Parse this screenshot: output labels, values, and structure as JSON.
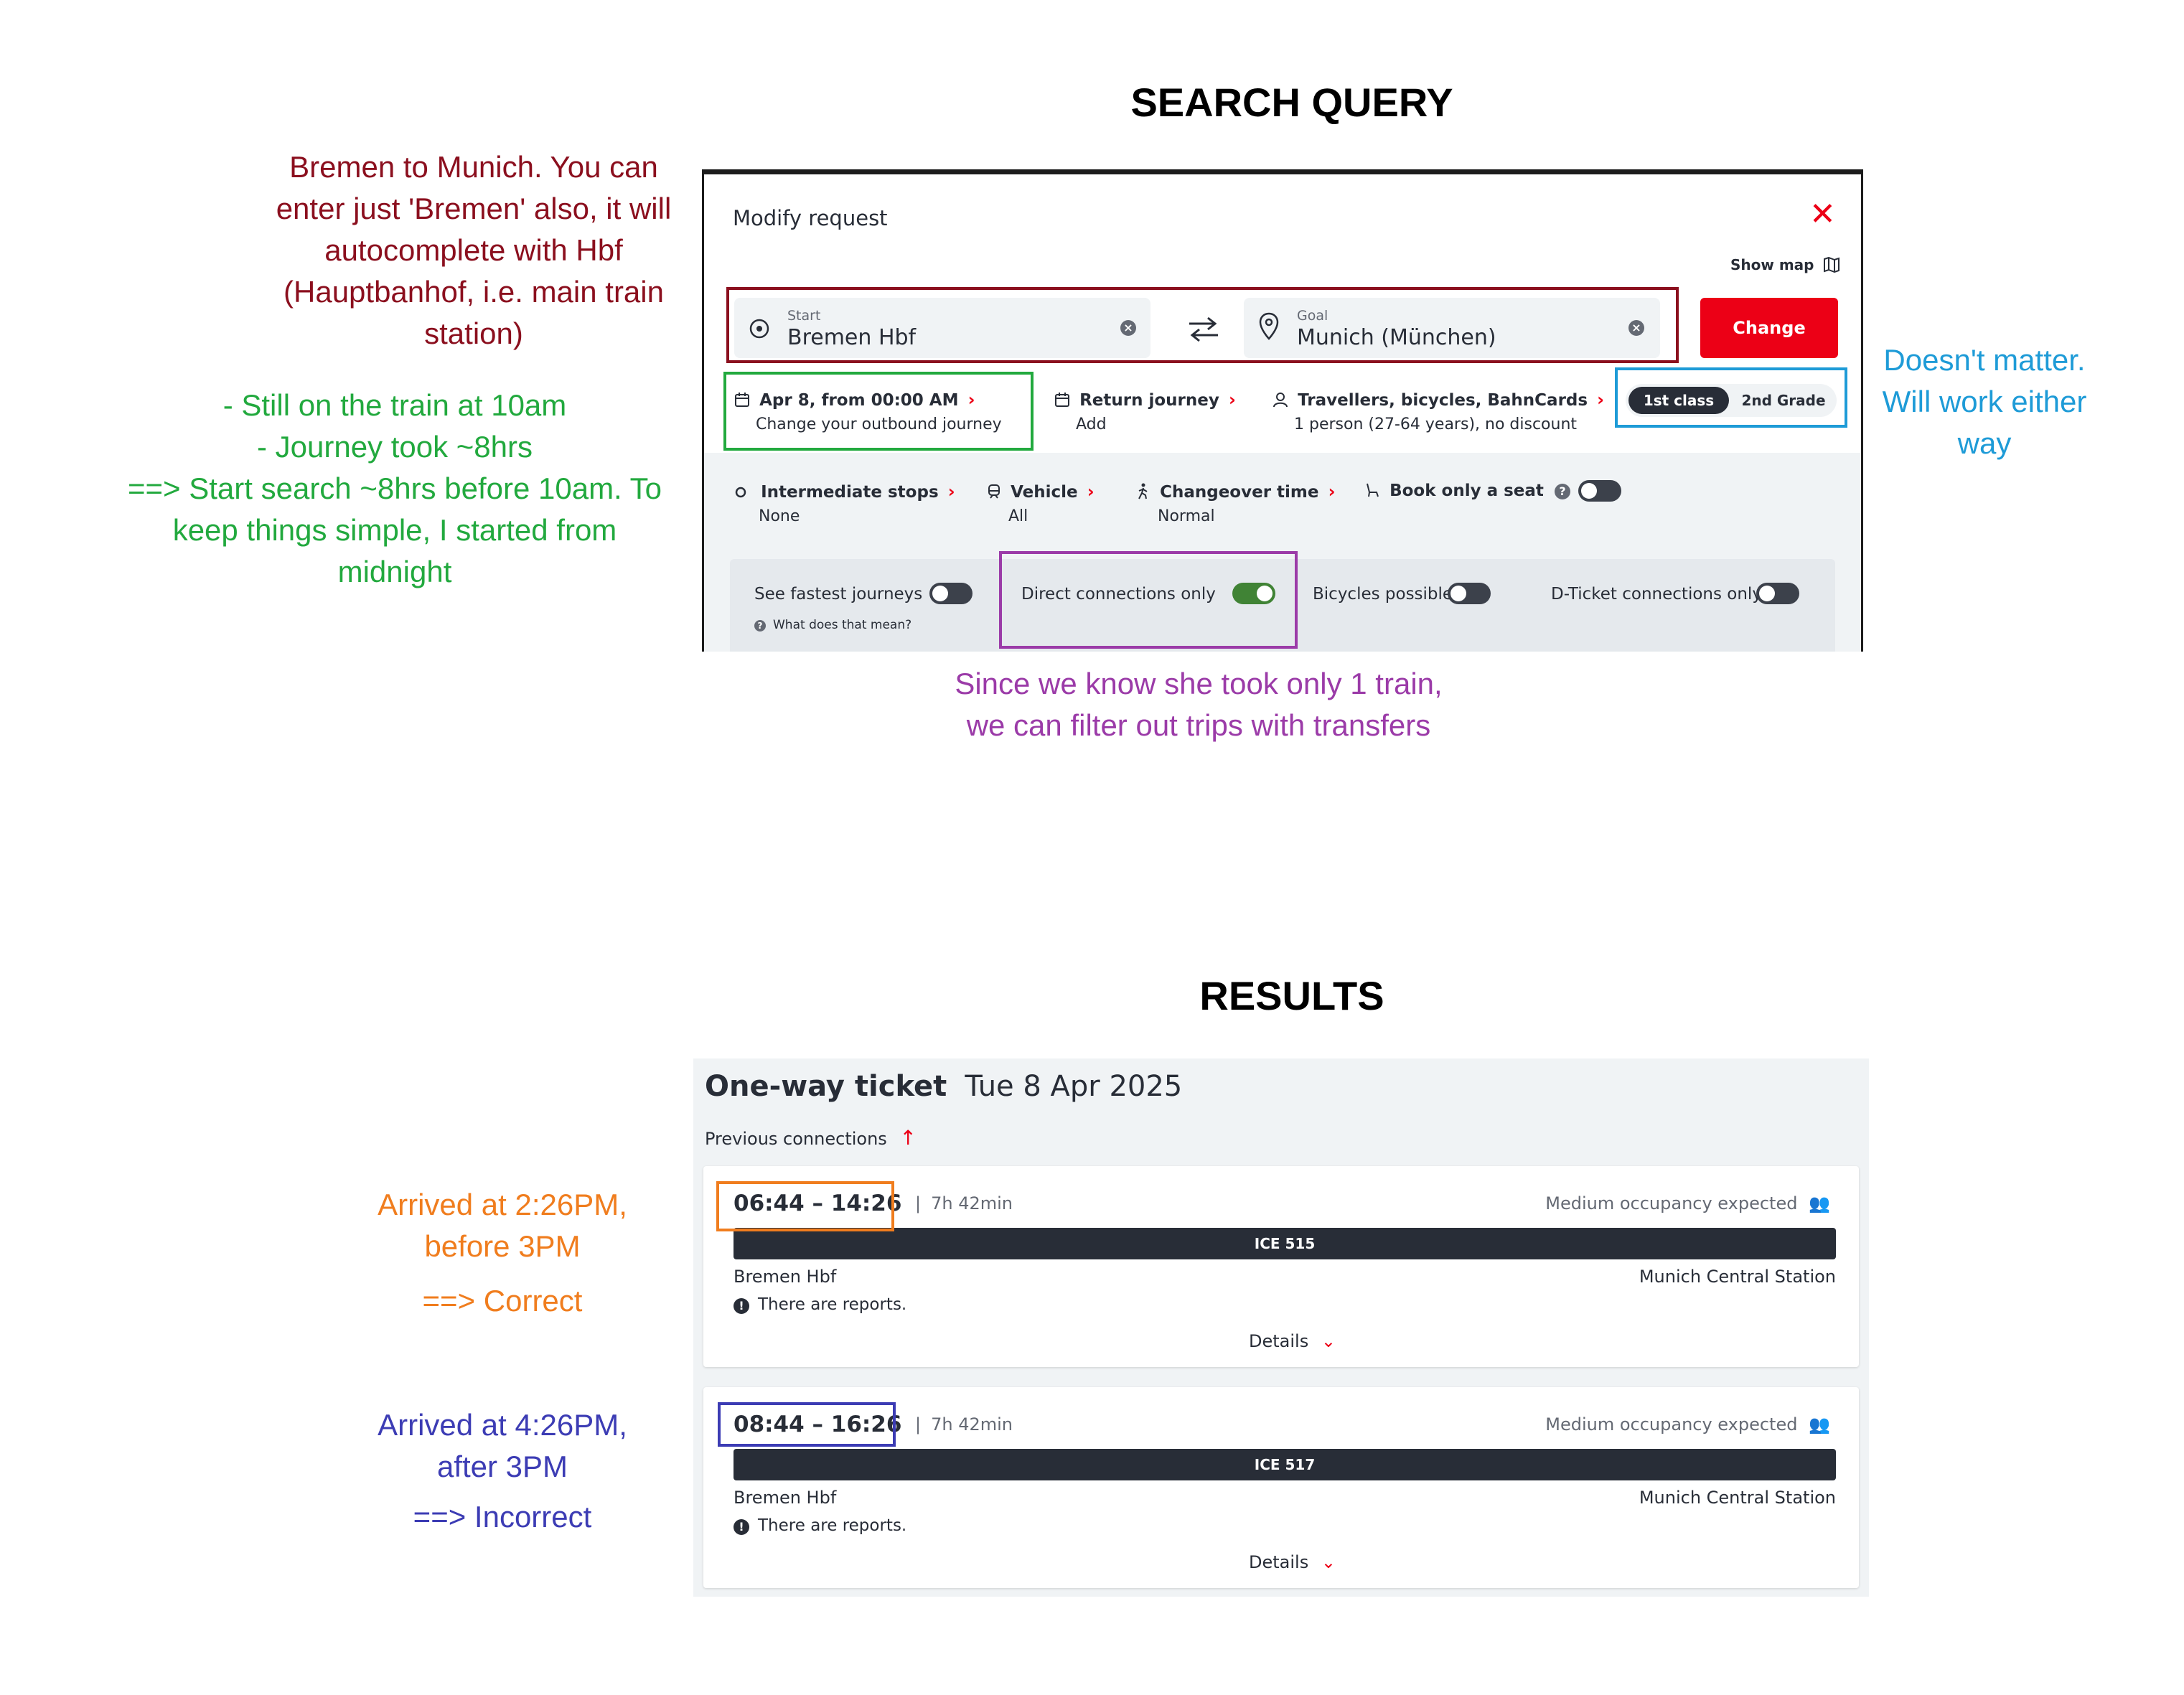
{
  "headings": {
    "search": "SEARCH QUERY",
    "results": "RESULTS"
  },
  "annotations": {
    "route": [
      "Bremen to Munich. You can",
      "enter just 'Bremen' also, it will",
      "autocomplete with Hbf",
      "(Hauptbanhof, i.e. main train",
      "station)"
    ],
    "time": [
      "- Still on the train at 10am",
      "- Journey took ~8hrs",
      "==> Start search ~8hrs before 10am. To",
      "keep things simple, I started from",
      "midnight"
    ],
    "class": [
      "Doesn't matter.",
      "Will work either",
      "way"
    ],
    "direct": [
      "Since we know she took only 1 train,",
      "we can filter out trips with transfers"
    ],
    "result1": [
      "Arrived at 2:26PM,",
      "before 3PM",
      "==> Correct"
    ],
    "result2": [
      "Arrived at 4:26PM,",
      "after 3PM",
      "==> Incorrect"
    ]
  },
  "colors": {
    "route": "#8b0f1e",
    "time": "#22a93e",
    "class": "#1e9bd7",
    "direct": "#9b3ba8",
    "result1": "#f07d1e",
    "result2": "#3c3cb4",
    "brand_red": "#ec0016",
    "toggle_on": "#408335"
  },
  "search": {
    "title": "Modify request",
    "close_icon": "close-icon",
    "show_map": "Show map",
    "start": {
      "label": "Start",
      "value": "Bremen Hbf"
    },
    "goal": {
      "label": "Goal",
      "value": "Munich (München)"
    },
    "change_button": "Change",
    "outbound": {
      "title": "Apr 8, from 00:00 AM",
      "sub": "Change your outbound journey"
    },
    "return": {
      "title": "Return journey",
      "sub": "Add"
    },
    "travellers": {
      "title": "Travellers, bicycles, BahnCards",
      "sub": "1 person (27-64 years), no discount"
    },
    "class_options": [
      "1st class",
      "2nd Grade"
    ],
    "class_selected": 0,
    "stops": {
      "title": "Intermediate stops",
      "sub": "None"
    },
    "vehicle": {
      "title": "Vehicle",
      "sub": "All"
    },
    "changeover": {
      "title": "Changeover time",
      "sub": "Normal"
    },
    "seat": {
      "title": "Book only a seat",
      "on": false
    },
    "filters": {
      "fastest": {
        "label": "See fastest journeys",
        "help": "What does that mean?",
        "on": false
      },
      "direct": {
        "label": "Direct connections only",
        "on": true
      },
      "bicycles": {
        "label": "Bicycles possible",
        "on": false
      },
      "dticket": {
        "label": "D-Ticket connections only",
        "on": false
      }
    }
  },
  "results": {
    "ticket_type": "One-way ticket",
    "date": "Tue 8 Apr 2025",
    "previous": "Previous connections",
    "connections": [
      {
        "times": "06:44 – 14:26",
        "duration": "7h 42min",
        "occupancy": "Medium occupancy expected",
        "train": "ICE 515",
        "from": "Bremen Hbf",
        "to": "Munich Central Station",
        "reports": "There are reports.",
        "details": "Details"
      },
      {
        "times": "08:44 – 16:26",
        "duration": "7h 42min",
        "occupancy": "Medium occupancy expected",
        "train": "ICE 517",
        "from": "Bremen Hbf",
        "to": "Munich Central Station",
        "reports": "There are reports.",
        "details": "Details"
      }
    ]
  }
}
